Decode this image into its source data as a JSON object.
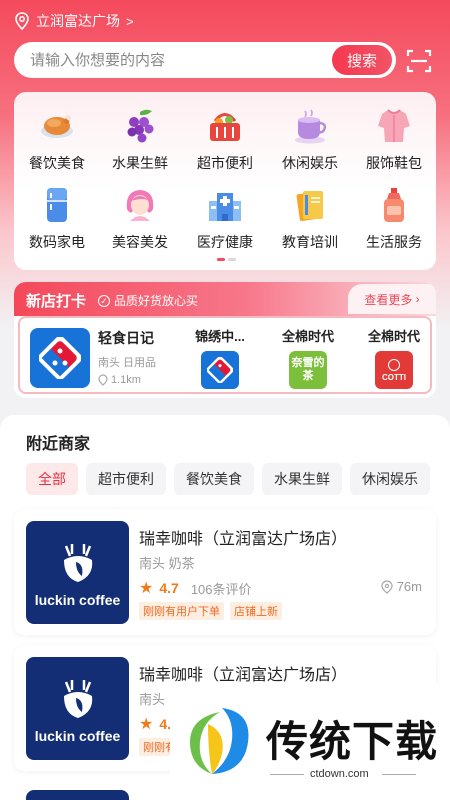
{
  "location": {
    "text": "立润富达广场",
    "chevron": ">"
  },
  "search": {
    "placeholder": "请输入你想要的内容",
    "button_label": "搜索"
  },
  "categories": [
    {
      "label": "餐饮美食",
      "icon": "roast-chicken-icon"
    },
    {
      "label": "水果生鲜",
      "icon": "grapes-icon"
    },
    {
      "label": "超市便利",
      "icon": "basket-icon"
    },
    {
      "label": "休闲娱乐",
      "icon": "coffee-cup-icon"
    },
    {
      "label": "服饰鞋包",
      "icon": "clothing-icon"
    },
    {
      "label": "数码家电",
      "icon": "fridge-icon"
    },
    {
      "label": "美容美发",
      "icon": "hair-salon-icon"
    },
    {
      "label": "医疗健康",
      "icon": "hospital-icon"
    },
    {
      "label": "教育培训",
      "icon": "books-icon"
    },
    {
      "label": "生活服务",
      "icon": "bottle-icon"
    }
  ],
  "new_shops": {
    "title": "新店打卡",
    "subtitle": "品质好货放心买",
    "more_label": "查看更多",
    "featured": {
      "name": "轻食日记",
      "tags": "南头 日用品",
      "distance": "1.1km"
    },
    "others": [
      {
        "name": "锦绣中...",
        "logo": "domino-logo"
      },
      {
        "name": "全棉时代",
        "logo": "naixue-logo",
        "logo_text": "奈雪的茶"
      },
      {
        "name": "全棉时代",
        "logo": "cotti-logo",
        "logo_text": "COTTI"
      }
    ]
  },
  "nearby": {
    "title": "附近商家",
    "filters": [
      "全部",
      "超市便利",
      "餐饮美食",
      "水果生鲜",
      "休闲娱乐"
    ],
    "merchants": [
      {
        "brand": "luckin coffee",
        "name": "瑞幸咖啡（立润富达广场店）",
        "tags": "南头 奶茶",
        "rating": "4.7",
        "reviews": "106条评价",
        "distance": "76m",
        "badges": [
          "刚刚有用户下单",
          "店铺上新"
        ]
      },
      {
        "brand": "luckin coffee",
        "name": "瑞幸咖啡（立润富达广场店）",
        "tags": "南头",
        "rating": "4.",
        "badges": [
          "刚刚有"
        ]
      }
    ]
  },
  "watermark": {
    "text": "传统下载",
    "url": "ctdown.com"
  },
  "colors": {
    "accent": "#f44a5c",
    "luckin_blue": "#132e74",
    "orange": "#f27a1a"
  }
}
